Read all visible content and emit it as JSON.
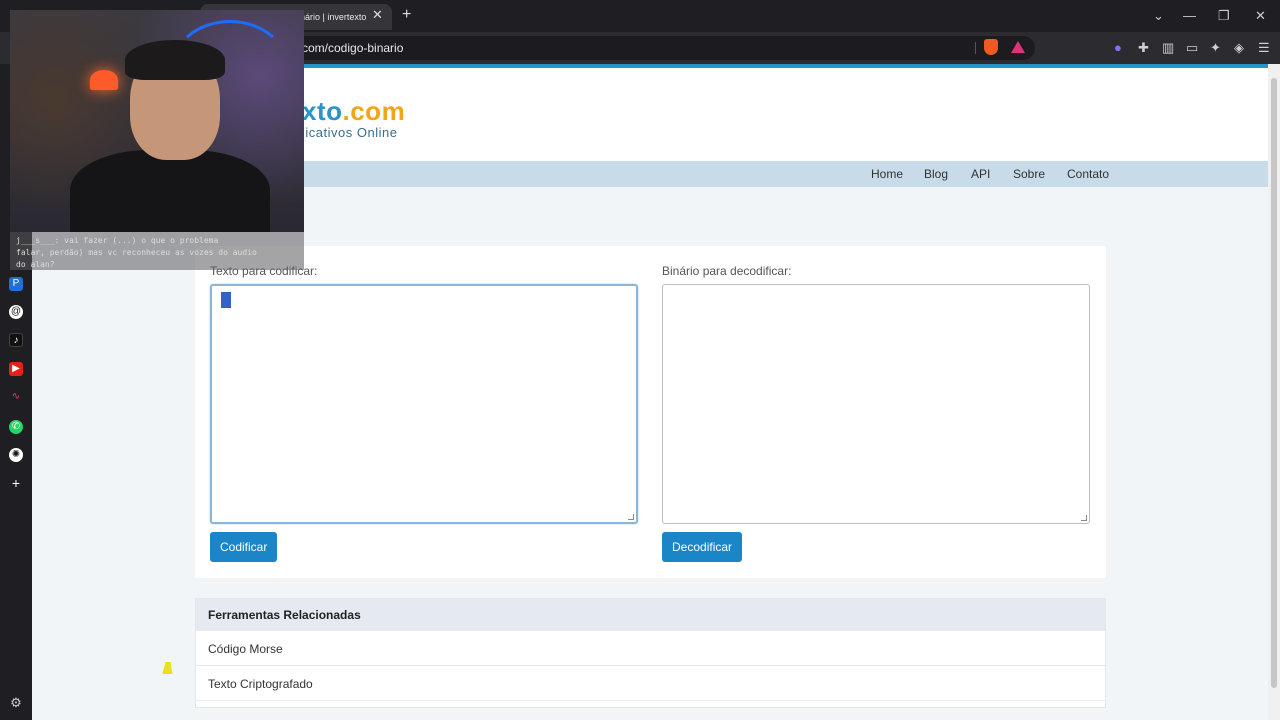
{
  "browser": {
    "tab_title": "nário | invertexto",
    "tab_close": "✕",
    "new_tab": "+",
    "url": "com/codigo-binario",
    "window_controls": {
      "chevron": "⌄",
      "minimize": "—",
      "restore": "❐",
      "close": "✕"
    }
  },
  "site": {
    "logo_text": "xto",
    "logo_dot": ".com",
    "tagline": "licativos Online",
    "nav": [
      "Home",
      "Blog",
      "API",
      "Sobre",
      "Contato"
    ]
  },
  "encoder": {
    "encode_label": "Texto para codificar:",
    "decode_label": "Binário para decodificar:",
    "encode_button": "Codificar",
    "decode_button": "Decodificar"
  },
  "related": {
    "title": "Ferramentas Relacionadas",
    "items": [
      "Código Morse",
      "Texto Criptografado"
    ]
  },
  "chat_overlay": {
    "line1": "j___s___: vai fazer (...) o que o problema",
    "line2": "falar, perdão) mas vc reconheceu as vozes do audio",
    "line3": "do alan?"
  },
  "colors": {
    "accent": "#1a86c8",
    "logo_blue": "#2a94c8",
    "logo_orange": "#f2a516",
    "nav_bg": "#c7dbe8"
  }
}
